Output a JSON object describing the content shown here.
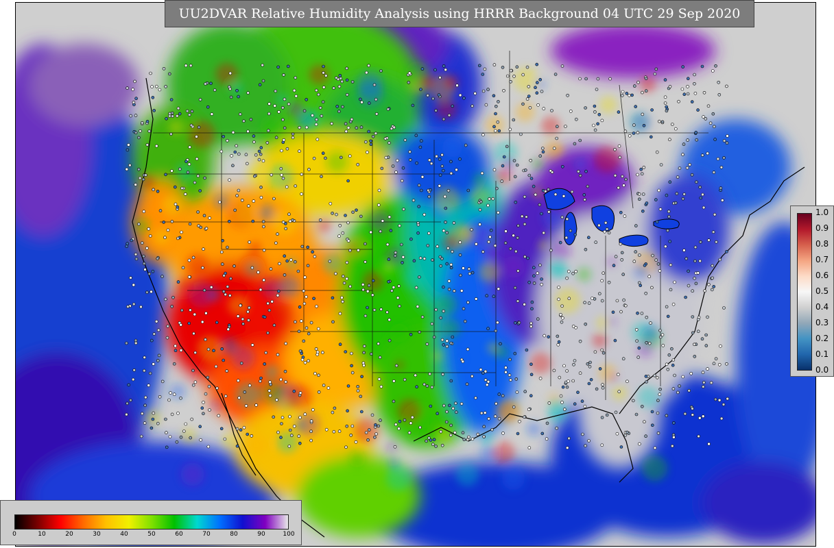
{
  "title": "UU2DVAR Relative Humidity Analysis using HRRR Background 04 UTC 29 Sep 2020",
  "colors": {
    "ocean": "#1030c8",
    "land_default": "#cfcfcf",
    "dry_red": "#e00000",
    "orange": "#ff9a00",
    "yellow": "#f0e000",
    "green": "#20c000",
    "blue": "#1060e0",
    "purple": "#7a10c0"
  },
  "right_legend": {
    "ticks": [
      "1.0",
      "0.9",
      "0.8",
      "0.7",
      "0.6",
      "0.5",
      "0.4",
      "0.3",
      "0.2",
      "0.1",
      "0.0"
    ],
    "gradient": [
      "#08306b",
      "#2166ac",
      "#4393c3",
      "#92a8b8",
      "#d0d0d0",
      "#f7f7f7",
      "#fddbc7",
      "#f4a582",
      "#d6604d",
      "#b2182b",
      "#67001f"
    ]
  },
  "bottom_legend": {
    "ticks": [
      "0",
      "10",
      "20",
      "30",
      "40",
      "50",
      "60",
      "70",
      "80",
      "90",
      "100"
    ],
    "gradient": [
      "#000000",
      "#7a0000",
      "#ff0000",
      "#ff6a00",
      "#ffc000",
      "#f0f000",
      "#80e000",
      "#00c000",
      "#00d8d0",
      "#0070ff",
      "#1010d0",
      "#8000c0",
      "#e8e8e8"
    ]
  },
  "icons": [
    "map-canvas",
    "station-markers",
    "state-borders"
  ]
}
